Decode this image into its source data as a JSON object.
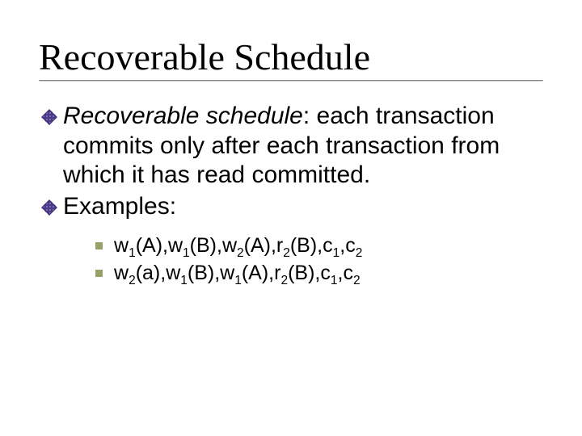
{
  "title": "Recoverable Schedule",
  "bullets": [
    {
      "runs": [
        {
          "t": "Recoverable schedule",
          "italic": true
        },
        {
          "t": ": each transaction commits only after each transaction from which it has read committed.",
          "italic": false
        }
      ]
    },
    {
      "runs": [
        {
          "t": "Examples:",
          "italic": false
        }
      ]
    }
  ],
  "examples": [
    {
      "tokens": [
        {
          "b": "w",
          "s": "1"
        },
        {
          "b": "(A),"
        },
        {
          "b": "w",
          "s": "1"
        },
        {
          "b": "(B),"
        },
        {
          "b": "w",
          "s": "2"
        },
        {
          "b": "(A),"
        },
        {
          "b": "r",
          "s": "2"
        },
        {
          "b": "(B),"
        },
        {
          "b": "c",
          "s": "1"
        },
        {
          "b": ","
        },
        {
          "b": "c",
          "s": "2"
        }
      ]
    },
    {
      "tokens": [
        {
          "b": "w",
          "s": "2"
        },
        {
          "b": "(a),"
        },
        {
          "b": "w",
          "s": "1"
        },
        {
          "b": "(B),"
        },
        {
          "b": "w",
          "s": "1"
        },
        {
          "b": "(A),"
        },
        {
          "b": "r",
          "s": "2"
        },
        {
          "b": "(B),"
        },
        {
          "b": "c",
          "s": "1"
        },
        {
          "b": ","
        },
        {
          "b": "c",
          "s": "2"
        }
      ]
    }
  ]
}
